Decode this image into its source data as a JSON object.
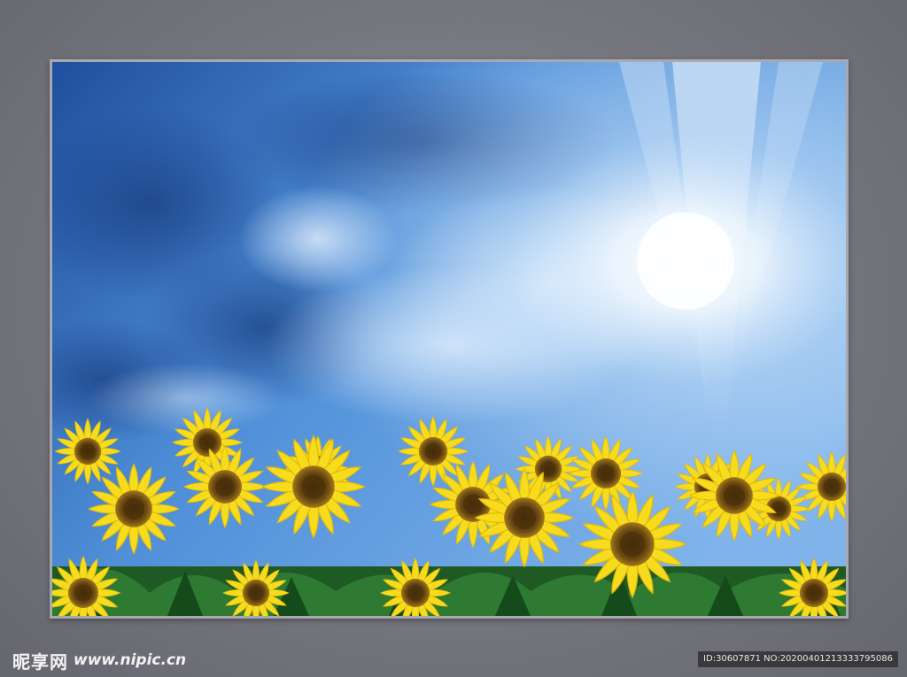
{
  "watermark": {
    "logo_text": "昵享网",
    "url": "www.nipic.cn",
    "id_text": "ID:30607871 NO:20200401213333795086"
  },
  "photo": {
    "subject": "sunflower field under blue sky with sunburst",
    "colors": {
      "sky_dark": "#1f4f9e",
      "sky_mid": "#4f8fd8",
      "sky_light": "#cfe6fb",
      "sun": "#ffffff",
      "petal": "#f7dc1e",
      "petal_shade": "#e3b90a",
      "center": "#6b4a12",
      "leaf": "#1f5a24",
      "background_wall": "#76767e",
      "frame_border": "#a8a8ae"
    }
  }
}
